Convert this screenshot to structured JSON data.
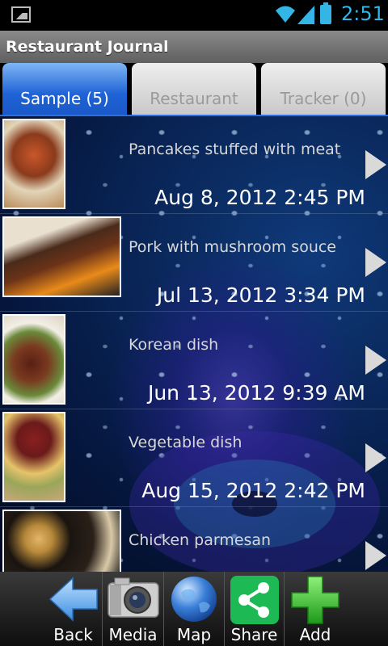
{
  "status_bar": {
    "time": "2:51"
  },
  "app_title": "Restaurant Journal",
  "tabs": [
    {
      "label": "Sample (5)",
      "active": true
    },
    {
      "label": "Restaurant",
      "active": false
    },
    {
      "label": "Tracker (0)",
      "active": false
    }
  ],
  "entries": [
    {
      "title": "Pancakes stuffed with meat",
      "date": "Aug 8, 2012 2:45 PM"
    },
    {
      "title": "Pork with mushroom souce",
      "date": "Jul 13, 2012 3:34 PM"
    },
    {
      "title": "Korean dish",
      "date": "Jun 13, 2012 9:39 AM"
    },
    {
      "title": "Vegetable dish",
      "date": "Aug 15, 2012 2:42 PM"
    },
    {
      "title": "Chicken parmesan",
      "date": ""
    }
  ],
  "toolbar": {
    "back": "Back",
    "media": "Media",
    "map": "Map",
    "share": "Share",
    "add": "Add"
  },
  "colors": {
    "accent": "#33b5e5",
    "tab_active": "#1f63d6",
    "share_green": "#1db954",
    "add_green": "#3fc33a"
  }
}
